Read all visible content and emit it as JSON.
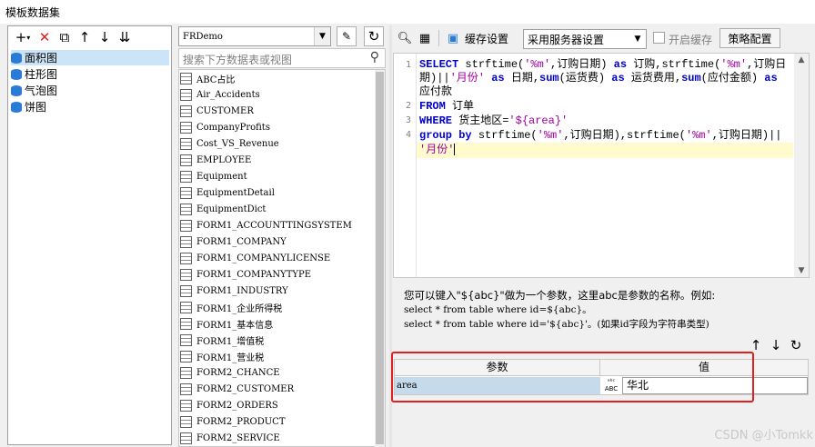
{
  "window": {
    "title": "模板数据集"
  },
  "left_toolbar": {
    "icons": [
      "add-icon",
      "delete-icon",
      "copy-icon",
      "up-icon",
      "down-icon",
      "sort-icon"
    ]
  },
  "datasets": [
    {
      "label": "面积图",
      "selected": true
    },
    {
      "label": "柱形图",
      "selected": false
    },
    {
      "label": "气泡图",
      "selected": false
    },
    {
      "label": "饼图",
      "selected": false
    }
  ],
  "connection": {
    "value": "FRDemo"
  },
  "table_search": {
    "placeholder": "搜索下方数据表或视图"
  },
  "tables": [
    "ABC占比",
    "Air_Accidents",
    "CUSTOMER",
    "CompanyProfits",
    "Cost_VS_Revenue",
    "EMPLOYEE",
    "Equipment",
    "EquipmentDetail",
    "EquipmentDict",
    "FORM1_ACCOUNTTINGSYSTEM",
    "FORM1_COMPANY",
    "FORM1_COMPANYLICENSE",
    "FORM1_COMPANYTYPE",
    "FORM1_INDUSTRY",
    "FORM1_企业所得税",
    "FORM1_基本信息",
    "FORM1_增值税",
    "FORM1_营业税",
    "FORM2_CHANCE",
    "FORM2_CUSTOMER",
    "FORM2_ORDERS",
    "FORM2_PRODUCT",
    "FORM2_SERVICE"
  ],
  "sql_toolbar": {
    "cache_setting_label": "缓存设置",
    "cache_mode": "采用服务器设置",
    "enable_cache_label": "开启缓存",
    "enable_cache_checked": false,
    "strategy_button": "策略配置"
  },
  "sql": {
    "line_numbers": [
      "1",
      "2",
      "3",
      "4"
    ],
    "line1a": {
      "kw1": "SELECT",
      "t1": " strftime(",
      "s1": "'%m'",
      "t2": ",订购日期) ",
      "kw2": "as",
      "t3": " 订购,strftime(",
      "s2": "'%m'",
      "t4": ",订购日"
    },
    "line1b": {
      "t1": "期)||",
      "s1": "'月份'",
      "t2": " ",
      "kw1": "as",
      "t3": " 日期,",
      "kw2": "sum",
      "t4": "(运货费) ",
      "kw3": "as",
      "t5": " 运货费用,",
      "kw4": "sum",
      "t6": "(应付金额) ",
      "kw5": "as"
    },
    "line1c": {
      "t1": "应付款"
    },
    "line2": {
      "kw1": "FROM",
      "t1": " 订单"
    },
    "line3": {
      "kw1": "WHERE",
      "t1": "  货主地区=",
      "s1": "'${area}'"
    },
    "line4a": {
      "kw1": "group",
      "t1": " ",
      "kw2": "by",
      "t2": " strftime(",
      "s1": "'%m'",
      "t3": ",订购日期),strftime(",
      "s2": "'%m'",
      "t4": ",订购日期)||"
    },
    "line4b": {
      "s1": "'月份'"
    }
  },
  "hint": {
    "line1": "您可以键入\"${abc}\"做为一个参数，这里abc是参数的名称。例如:",
    "line2": "select * from table where id=${abc}。",
    "line3": "select * from table where id='${abc}'。(如果id字段为字符串类型)"
  },
  "params": {
    "headers": [
      "参数",
      "值"
    ],
    "rows": [
      {
        "name": "area",
        "value": "华北"
      }
    ],
    "highlight_color": "#e02020"
  },
  "watermark": "CSDN @小Tomkk"
}
